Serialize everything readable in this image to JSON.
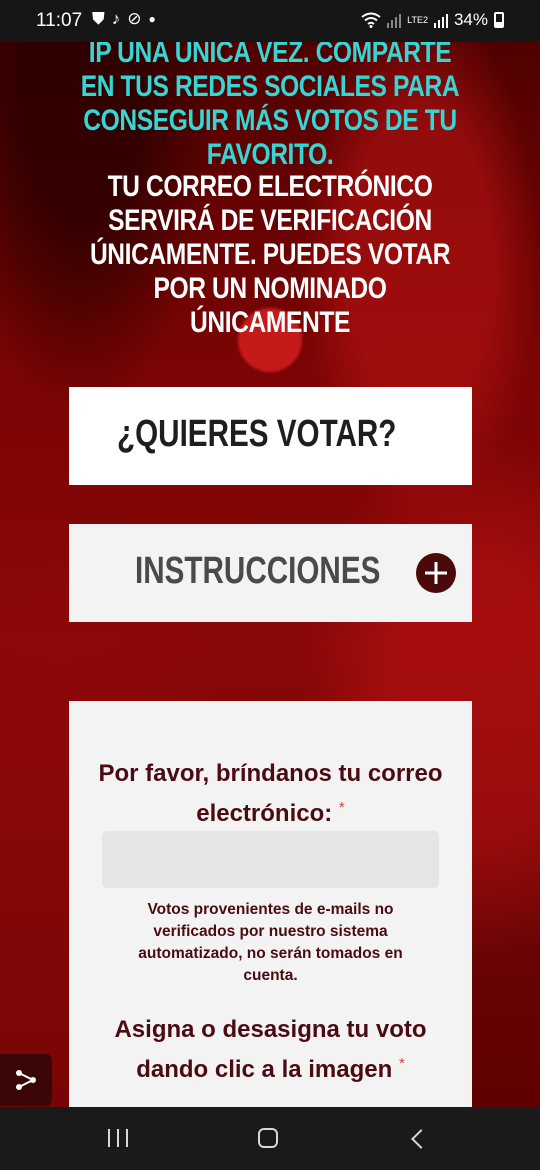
{
  "status_bar": {
    "time": "11:07",
    "battery": "34%",
    "network_label": "LTE2",
    "icons": [
      "shield-icon",
      "tiktok-icon",
      "media-icon",
      "dot-icon",
      "wifi-icon",
      "signal-icon",
      "battery-icon"
    ]
  },
  "intro": {
    "cyan_text": "IP UNA ÚNICA VEZ.  COMPARTE EN TUS REDES SOCIALES PARA CONSEGUIR MÁS VOTOS DE TU FAVORITO.",
    "white_text": "TU CORREO ELECTRÓNICO SERVIRÁ DE VERIFICACIÓN ÚNICAMENTE.  PUEDES VOTAR POR UN NOMINADO ÚNICAMENTE"
  },
  "vote_section": {
    "title": "¿QUIERES VOTAR?"
  },
  "instructions_section": {
    "title": "INSTRUCCIONES",
    "toggle_icon": "plus-circle-icon"
  },
  "form": {
    "email_label": "Por favor, bríndanos tu correo electrónico:",
    "required_mark": "*",
    "email_value": "",
    "email_note": "Votos provenientes de e-mails no verificados por nuestro sistema automatizado, no serán tomados en cuenta.",
    "vote_label": "Asigna o desasigna tu voto dando clic a la imagen",
    "vote_required_mark": "*"
  },
  "colors": {
    "accent_cyan": "#35d6d4",
    "label_maroon": "#4a0b12",
    "background_red": "#7a0404"
  },
  "nav_bar": {
    "icons": [
      "recent-apps-icon",
      "home-icon",
      "back-icon"
    ]
  }
}
